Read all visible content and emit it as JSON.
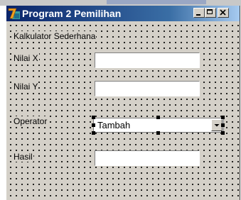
{
  "window": {
    "title": "Program 2 Pemilihan",
    "icon": "vb-app-icon",
    "buttons": [
      "minimize-icon",
      "maximize-icon",
      "close-icon"
    ]
  },
  "form": {
    "heading": "Kalkulator Sederhana",
    "fields": [
      {
        "label": "Nilai X",
        "value": ""
      },
      {
        "label": "Nilai Y",
        "value": ""
      }
    ],
    "operator": {
      "label": "Operator",
      "selected": "Tambah"
    },
    "result": {
      "label": "Hasil",
      "value": ""
    }
  },
  "colors": {
    "titlebar_start": "#0a246a",
    "titlebar_end": "#a6caf0",
    "form_background": "#d4d0c8",
    "selection_handle": "#000000"
  }
}
